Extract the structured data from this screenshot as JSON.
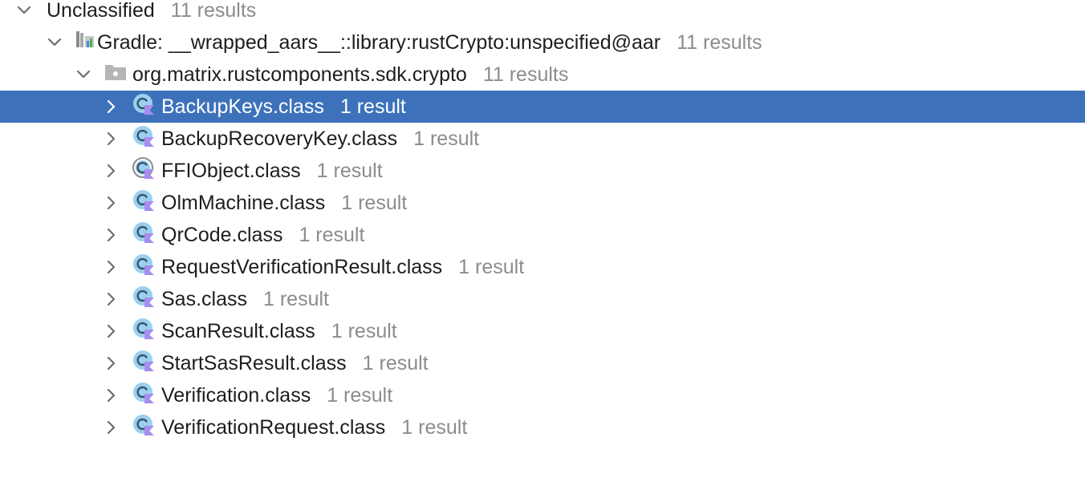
{
  "tree": {
    "root": {
      "label": "Unclassified",
      "count": "11 results"
    },
    "library": {
      "label": "Gradle: __wrapped_aars__::library:rustCrypto:unspecified@aar",
      "count": "11 results"
    },
    "package": {
      "label": "org.matrix.rustcomponents.sdk.crypto",
      "count": "11 results"
    },
    "classes": [
      {
        "label": "BackupKeys.class",
        "count": "1 result",
        "icon": "kotlin-class-icon",
        "selected": true
      },
      {
        "label": "BackupRecoveryKey.class",
        "count": "1 result",
        "icon": "kotlin-class-icon",
        "selected": false
      },
      {
        "label": "FFIObject.class",
        "count": "1 result",
        "icon": "kotlin-abstract-class-icon",
        "selected": false
      },
      {
        "label": "OlmMachine.class",
        "count": "1 result",
        "icon": "kotlin-class-icon",
        "selected": false
      },
      {
        "label": "QrCode.class",
        "count": "1 result",
        "icon": "kotlin-class-icon",
        "selected": false
      },
      {
        "label": "RequestVerificationResult.class",
        "count": "1 result",
        "icon": "kotlin-class-icon",
        "selected": false
      },
      {
        "label": "Sas.class",
        "count": "1 result",
        "icon": "kotlin-class-icon",
        "selected": false
      },
      {
        "label": "ScanResult.class",
        "count": "1 result",
        "icon": "kotlin-class-icon",
        "selected": false
      },
      {
        "label": "StartSasResult.class",
        "count": "1 result",
        "icon": "kotlin-class-icon",
        "selected": false
      },
      {
        "label": "Verification.class",
        "count": "1 result",
        "icon": "kotlin-class-icon",
        "selected": false
      },
      {
        "label": "VerificationRequest.class",
        "count": "1 result",
        "icon": "kotlin-class-icon",
        "selected": false
      }
    ]
  },
  "colors": {
    "selection": "#3d72bb",
    "secondary_text": "#8c8c8c",
    "class_icon_fill": "#9ad0f0",
    "kotlin_marker": "#a98cf0"
  }
}
